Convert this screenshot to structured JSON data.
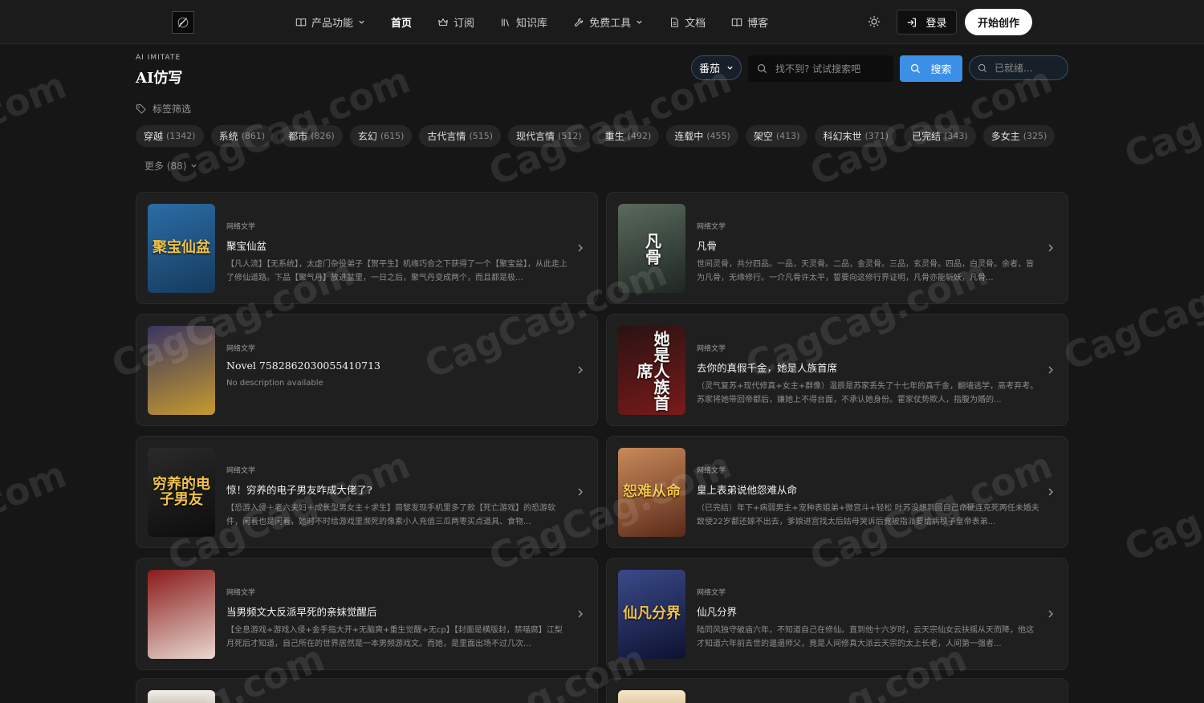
{
  "nav": {
    "items": [
      {
        "label": "产品功能",
        "icon": "book-open-icon",
        "dropdown": true
      },
      {
        "label": "首页",
        "active": true
      },
      {
        "label": "订阅",
        "icon": "crown-icon"
      },
      {
        "label": "知识库",
        "icon": "library-icon"
      },
      {
        "label": "免费工具",
        "icon": "wrench-icon",
        "dropdown": true
      },
      {
        "label": "文档",
        "icon": "document-icon"
      },
      {
        "label": "博客",
        "icon": "book-icon"
      }
    ],
    "login_label": "登录",
    "start_label": "开始创作"
  },
  "page": {
    "eyebrow": "AI IMITATE",
    "title": "AI仿写"
  },
  "search": {
    "source_select": "番茄",
    "placeholder": "找不到? 试试搜索吧",
    "button_label": "搜索",
    "status_placeholder": "已就绪..."
  },
  "filter": {
    "label": "标签筛选",
    "tags": [
      {
        "name": "穿越",
        "count": "(1342)"
      },
      {
        "name": "系统",
        "count": "(861)"
      },
      {
        "name": "都市",
        "count": "(826)"
      },
      {
        "name": "玄幻",
        "count": "(615)"
      },
      {
        "name": "古代言情",
        "count": "(515)"
      },
      {
        "name": "现代言情",
        "count": "(512)"
      },
      {
        "name": "重生",
        "count": "(492)"
      },
      {
        "name": "连载中",
        "count": "(455)"
      },
      {
        "name": "架空",
        "count": "(413)"
      },
      {
        "name": "科幻末世",
        "count": "(371)"
      },
      {
        "name": "已完结",
        "count": "(343)"
      },
      {
        "name": "多女主",
        "count": "(325)"
      }
    ],
    "more_label": "更多 (88)"
  },
  "books": [
    {
      "category": "网络文学",
      "title": "聚宝仙盆",
      "desc": "【凡人流】【无系统】，太虚门杂役弟子【贺平生】机缘巧合之下获得了一个【聚宝盆】，从此走上了修仙道路。下品【聚气丹】放进盆里，一日之后，聚气丹变成两个，而且都是极...",
      "cover_text": "聚宝仙盆",
      "cover_colors": [
        "#2b6da6",
        "#163a5c"
      ]
    },
    {
      "category": "网络文学",
      "title": "凡骨",
      "desc": "世间灵骨，共分四品。一品，天灵骨。二品，金灵骨。三品，玄灵骨。四品，白灵骨。余者，皆为凡骨，无缘修行。一介凡骨许太平，誓要向这修行界证明，凡骨亦能斩妖，凡骨...",
      "cover_text": "凡骨",
      "cover_colors": [
        "#5a6a5e",
        "#1e2620"
      ]
    },
    {
      "category": "网络文学",
      "title": "Novel 7582862030055410713",
      "desc": "No description available",
      "cover_text": "",
      "cover_colors": [
        "#3a3560",
        "#c79a2e"
      ]
    },
    {
      "category": "网络文学",
      "title": "去你的真假千金，她是人族首席",
      "desc": "（灵气复苏+现代修真+女主+群像）温辰是苏家丢失了十七年的真千金，翻墙逃学，高考弃考。苏家将她带回帝都后，嫌她上不得台面，不承认她身份。霍家仗势欺人，指腹为婚的...",
      "cover_text": "她是人族首席",
      "cover_colors": [
        "#2a1212",
        "#7a1a1a"
      ]
    },
    {
      "category": "网络文学",
      "title": "惊！穷养的电子男友咋成大佬了?",
      "desc": "【恐游入侵＋老六夫妇＋成长型男女主＋求生】简黎发现手机里多了款【死亡游戏】的恐游软件，闲着也是闲着，她时不时给游戏里濒死的像素小人充值三瓜两枣买点道具、食物...",
      "cover_text": "穷养的电子男友",
      "cover_colors": [
        "#2a2a2a",
        "#0d0d0d"
      ]
    },
    {
      "category": "网络文学",
      "title": "皇上表弟说他怨难从命",
      "desc": "（已完结）年下+病弱男主+宠种表姐弟+微宫斗+轻松 叶苏没想到回自己命硬连克死两任未婚夫致使22岁都还嫁不出去，爹娘进宫找太后姑母哭诉后竟被指派要给病秧子皇帝表弟...",
      "cover_text": "恕难从命",
      "cover_colors": [
        "#c98a5a",
        "#5a2a1a"
      ]
    },
    {
      "category": "网络文学",
      "title": "当男频文大反派早死的亲妹觉醒后",
      "desc": "【全息游戏+游戏入侵+金手指大开+无脑爽+重生觉醒+无cp】【封面是横版封，禁喵腐】江梨月死后才知道，自己所在的世界居然是一本男频游戏文。而她，是里面出场不过几次...",
      "cover_text": "",
      "cover_colors": [
        "#8a1a1a",
        "#e8d8d0"
      ]
    },
    {
      "category": "网络文学",
      "title": "仙凡分界",
      "desc": "陆同风独守破庙六年，不知道自己在修仙。直到他十六岁时，云天宗仙女云扶摇从天而降，他这才知道六年前去世的邋遢师父，竟是人间修真大派云天宗的太上长老，人间第一强者...",
      "cover_text": "仙凡分界",
      "cover_colors": [
        "#3a4a8a",
        "#0e1230"
      ]
    }
  ],
  "colors": {
    "accent": "#3c8fe6",
    "background": "#161616",
    "card": "#1f1f1f"
  }
}
